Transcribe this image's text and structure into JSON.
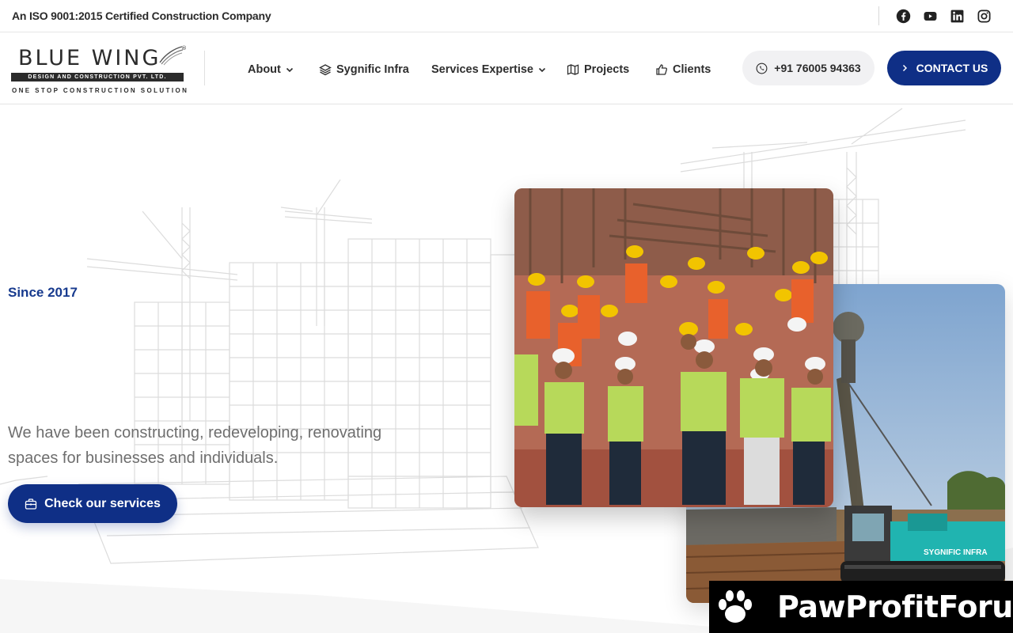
{
  "topbar": {
    "tagline": "An ISO 9001:2015 Certified Construction Company",
    "social": [
      {
        "icon": "facebook-icon"
      },
      {
        "icon": "youtube-icon"
      },
      {
        "icon": "linkedin-icon"
      },
      {
        "icon": "instagram-icon"
      }
    ]
  },
  "header": {
    "logo": {
      "name": "BLUE WING",
      "registered": "®",
      "bar_text": "DESIGN AND CONSTRUCTION PVT. LTD.",
      "sub_text": "ONE STOP CONSTRUCTION SOLUTION"
    },
    "nav": [
      {
        "label": "About",
        "icon": "",
        "dropdown": true
      },
      {
        "label": "Sygnific Infra",
        "icon": "layers-icon",
        "dropdown": false
      },
      {
        "label": "Services Expertise",
        "icon": "",
        "dropdown": true
      },
      {
        "label": "Projects",
        "icon": "map-icon",
        "dropdown": false
      },
      {
        "label": "Clients",
        "icon": "thumbs-up-icon",
        "dropdown": false
      }
    ],
    "phone": "+91 76005 94363",
    "contact_label": "CONTACT US"
  },
  "hero": {
    "since": "Since 2017",
    "description": "We have been constructing, redeveloping, renovating spaces for businesses and individuals.",
    "cta_label": "Check our services",
    "photo_front_alt": "construction team in hard hats and safety vests",
    "photo_back_alt": "excavator at construction site",
    "machine_label": "SYGNIFIC INFRA"
  },
  "watermark": {
    "text": "PawProfitForum"
  },
  "colors": {
    "primary": "#0f2f86",
    "accent_text": "#173a8e",
    "body_text": "#6e6e6e"
  }
}
